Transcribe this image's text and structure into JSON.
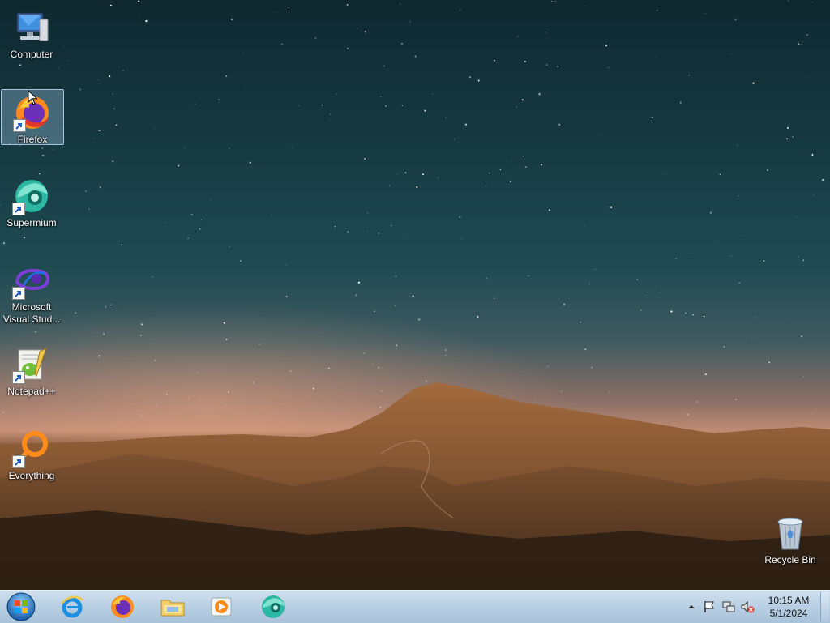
{
  "desktop": {
    "icons": [
      {
        "label": "Computer",
        "icon": "computer-icon"
      },
      {
        "label": "Firefox",
        "icon": "firefox-icon",
        "selected": true
      },
      {
        "label": "Supermium",
        "icon": "supermium-icon"
      },
      {
        "label": "Microsoft\nVisual Stud...",
        "icon": "visual-studio-icon"
      },
      {
        "label": "Notepad++",
        "icon": "notepadpp-icon"
      },
      {
        "label": "Everything",
        "icon": "everything-icon"
      },
      {
        "label": "Recycle Bin",
        "icon": "recycle-bin-icon"
      }
    ]
  },
  "taskbar": {
    "pinned": [
      {
        "name": "internet-explorer",
        "icon": "ie-icon"
      },
      {
        "name": "firefox",
        "icon": "firefox-icon"
      },
      {
        "name": "file-explorer",
        "icon": "folder-icon"
      },
      {
        "name": "media-player",
        "icon": "media-player-icon"
      },
      {
        "name": "supermium",
        "icon": "supermium-icon"
      }
    ],
    "tray": {
      "icons": [
        "show-hidden-icons-arrow",
        "action-center-flag-icon",
        "network-icon",
        "volume-muted-icon"
      ],
      "time": "10:15 AM",
      "date": "5/1/2024"
    }
  }
}
